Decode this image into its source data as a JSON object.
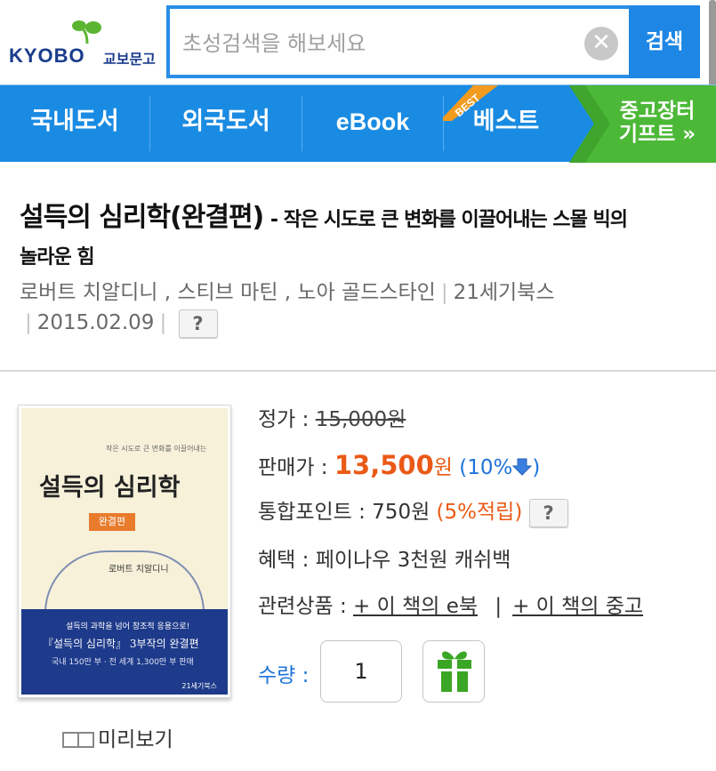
{
  "header": {
    "logo_text": "KYOBO",
    "logo_ko": "교보문고",
    "search_placeholder": "초성검색을 해보세요",
    "clear_symbol": "✕",
    "search_button": "검색"
  },
  "nav": {
    "items": [
      "국내도서",
      "외국도서",
      "eBook",
      "베스트"
    ],
    "best_badge": "BEST",
    "used_line1": "중고장터",
    "used_line2": "기프트 »"
  },
  "book": {
    "title": "설득의 심리학(완결편)",
    "subtitle": "- 작은 시도로 큰 변화를 이끌어내는 스몰 빅의",
    "subtitle_cont": "놀라운 힘",
    "authors": "로버트 치알디니 , 스티브 마틴 , 노아 골드스타인",
    "publisher": "21세기북스",
    "date": "2015.02.09",
    "help": "?"
  },
  "cover": {
    "small_text": "작은 시도로 큰 변화를 이끌어내는",
    "main_title": "설득의 심리학",
    "stamp": "완결편",
    "author": "로버트 치알디니",
    "band_line1": "설득의 과학을 넘어 창조적 응용으로!",
    "band_line2": "『설득의 심리학』 3부작의 완결편",
    "band_line3": "국내 150만 부 · 전 세계 1,300만 부 판매",
    "publisher": "21세기북스"
  },
  "price": {
    "list_label": "정가 : ",
    "list_price": "15,000원",
    "sale_label": "판매가 : ",
    "sale_price": "13,500",
    "sale_unit": "원",
    "discount": "(10%",
    "discount_close": ")",
    "point_label": "통합포인트 : 750원 ",
    "point_rate": "(5%적립)",
    "benefit": "혜택 : 페이나우 3천원 캐쉬백",
    "related_label": "관련상품 : ",
    "related_ebook": "+ 이 책의 e북",
    "related_sep": "|",
    "related_used": "+ 이 책의 중고",
    "qty_label": "수량 : ",
    "qty_value": "1"
  },
  "preview_label": "미리보기",
  "colors": {
    "nav_blue": "#1a8be2",
    "search_border": "#2a8ee8",
    "used_green": "#4cb837",
    "sale_orange": "#ea5a16",
    "link_blue": "#1e74d8"
  }
}
